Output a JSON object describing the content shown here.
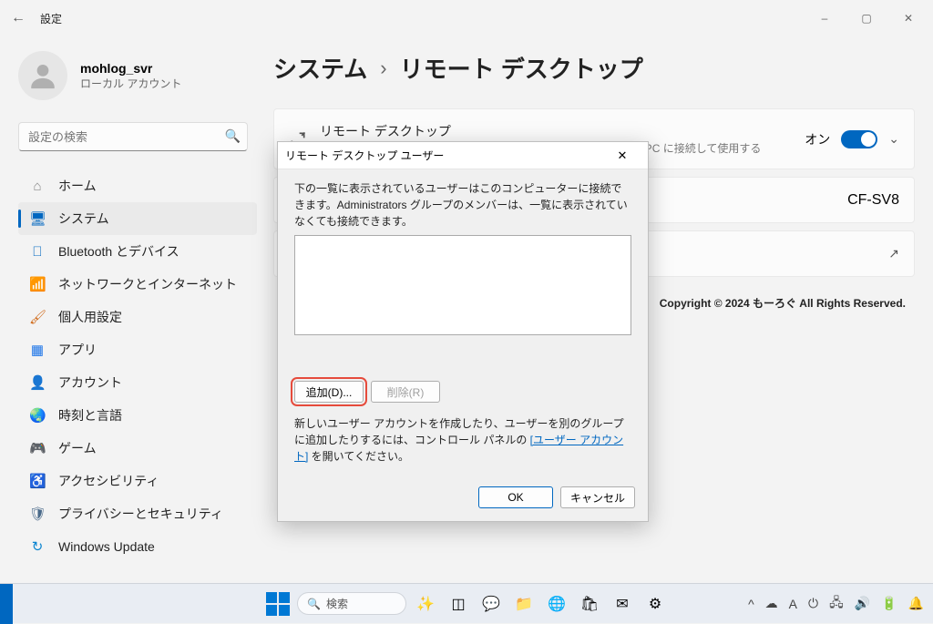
{
  "window": {
    "title": "設定"
  },
  "profile": {
    "name": "mohlog_svr",
    "sub": "ローカル アカウント"
  },
  "search": {
    "placeholder": "設定の検索"
  },
  "nav": {
    "items": [
      {
        "label": "ホーム"
      },
      {
        "label": "システム"
      },
      {
        "label": "Bluetooth とデバイス"
      },
      {
        "label": "ネットワークとインターネット"
      },
      {
        "label": "個人用設定"
      },
      {
        "label": "アプリ"
      },
      {
        "label": "アカウント"
      },
      {
        "label": "時刻と言語"
      },
      {
        "label": "ゲーム"
      },
      {
        "label": "アクセシビリティ"
      },
      {
        "label": "プライバシーとセキュリティ"
      },
      {
        "label": "Windows Update"
      }
    ]
  },
  "breadcrumb": {
    "root": "システム",
    "leaf": "リモート デスクトップ"
  },
  "card_rd": {
    "title": "リモート デスクトップ",
    "desc": "リモート デスクトップ アプリを使用して、別のデバイスからこの PC に接続して使用する",
    "state": "オン"
  },
  "card_pc": {
    "value": "CF-SV8"
  },
  "dialog": {
    "title": "リモート デスクトップ ユーザー",
    "msg": "下の一覧に表示されているユーザーはこのコンピューターに接続できます。Administrators グループのメンバーは、一覧に表示されていなくても接続できます。",
    "add": "追加(D)...",
    "remove": "削除(R)",
    "help1": "新しいユーザー アカウントを作成したり、ユーザーを別のグループに追加したりするには、コントロール パネルの ",
    "help_link": "[ユーザー アカウント]",
    "help2": " を開いてください。",
    "ok": "OK",
    "cancel": "キャンセル"
  },
  "copyright": "Copyright © 2024 もーろぐ All Rights Reserved.",
  "taskbar": {
    "search": "検索",
    "ime": "A"
  }
}
